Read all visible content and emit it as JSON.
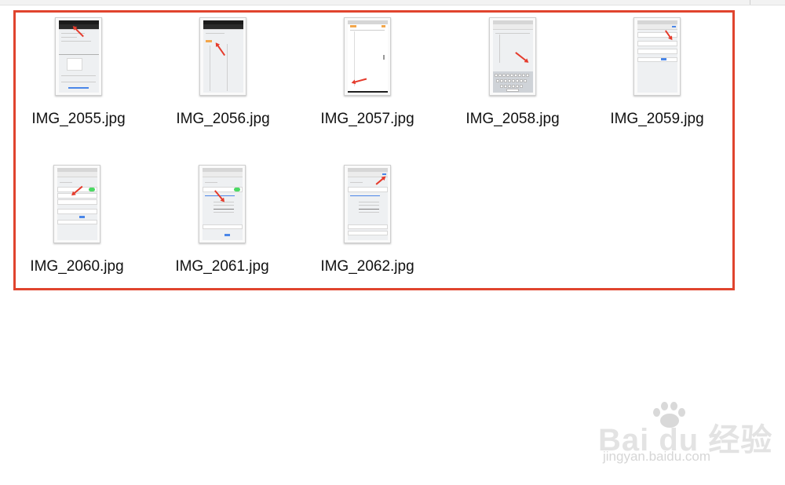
{
  "files": [
    {
      "name": "IMG_2055.jpg"
    },
    {
      "name": "IMG_2056.jpg"
    },
    {
      "name": "IMG_2057.jpg"
    },
    {
      "name": "IMG_2058.jpg"
    },
    {
      "name": "IMG_2059.jpg"
    },
    {
      "name": "IMG_2060.jpg"
    },
    {
      "name": "IMG_2061.jpg"
    },
    {
      "name": "IMG_2062.jpg"
    }
  ],
  "watermark": {
    "brand": "Bai du 经验",
    "url": "jingyan.baidu.com"
  },
  "colors": {
    "highlight_border": "#e0442e",
    "annotation_arrow": "#e53b2c"
  }
}
